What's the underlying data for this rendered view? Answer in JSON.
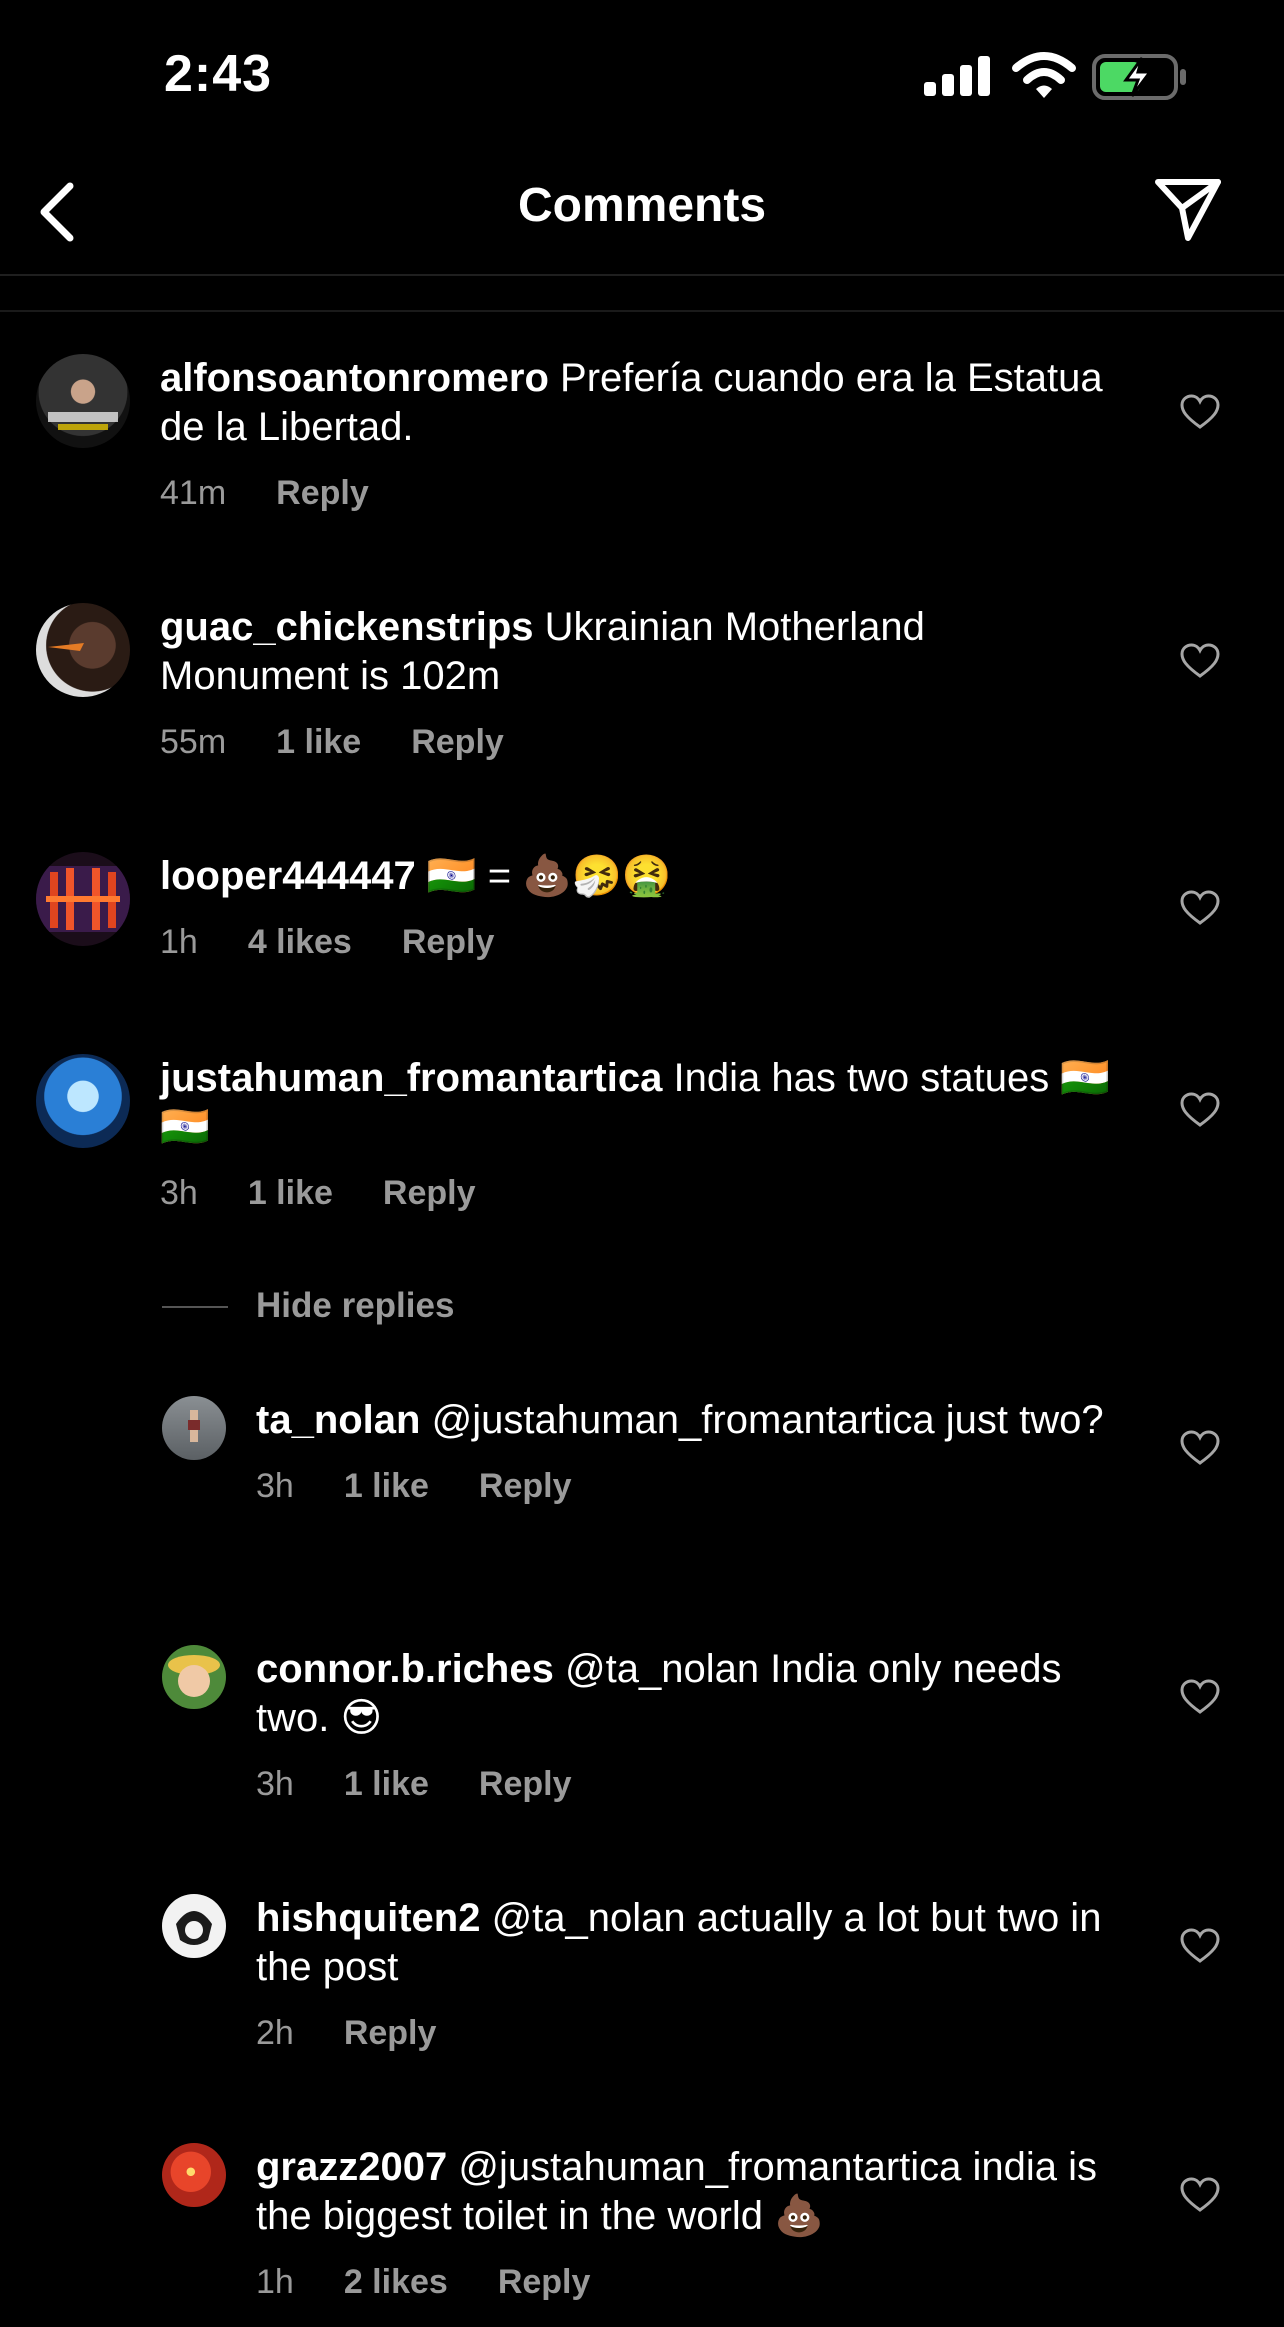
{
  "status": {
    "time": "2:43"
  },
  "header": {
    "title": "Comments"
  },
  "comments": [
    {
      "username": "alfonsoantonromero",
      "text": "Prefería cuando era la Estatua de la Libertad.",
      "time": "41m",
      "likes": "",
      "reply": "Reply"
    },
    {
      "username": "guac_chickenstrips",
      "text": "Ukrainian Motherland Monument is 102m",
      "time": "55m",
      "likes": "1 like",
      "reply": "Reply"
    },
    {
      "username": "looper444447",
      "text": "🇮🇳 = 💩🤧🤮",
      "time": "1h",
      "likes": "4 likes",
      "reply": "Reply"
    },
    {
      "username": "justahuman_fromantartica",
      "text": "India has two statues 🇮🇳 🇮🇳",
      "time": "3h",
      "likes": "1 like",
      "reply": "Reply"
    }
  ],
  "hide_replies_label": "Hide replies",
  "replies": [
    {
      "username": "ta_nolan",
      "text": "@justahuman_fromantartica just two?",
      "time": "3h",
      "likes": "1 like",
      "reply": "Reply"
    },
    {
      "username": "connor.b.riches",
      "text": "@ta_nolan India only needs two. 😎",
      "time": "3h",
      "likes": "1 like",
      "reply": "Reply"
    },
    {
      "username": "hishquiten2",
      "text": "@ta_nolan actually a lot but two in the post",
      "time": "2h",
      "likes": "",
      "reply": "Reply"
    },
    {
      "username": "grazz2007",
      "text": "@justahuman_fromantartica india is the biggest toilet in the world 💩",
      "time": "1h",
      "likes": "2 likes",
      "reply": "Reply"
    }
  ],
  "colors": {
    "background": "#000000",
    "secondary_text": "#9a9a9a",
    "battery": "#4cd964"
  },
  "icons": [
    "back-chevron-icon",
    "send-icon",
    "heart-icon",
    "signal-icon",
    "wifi-icon",
    "battery-charging-icon"
  ]
}
